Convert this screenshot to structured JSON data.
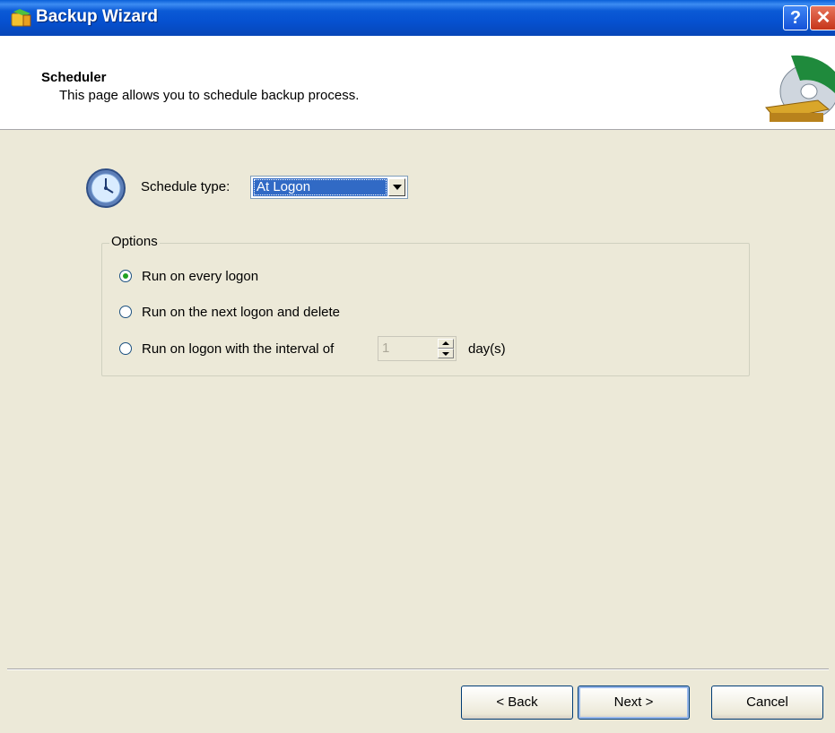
{
  "window": {
    "title": "Backup Wizard",
    "help_label": "?",
    "close_label": "✕"
  },
  "header": {
    "title": "Scheduler",
    "subtitle": "This page allows you to schedule backup process."
  },
  "schedule": {
    "label": "Schedule type:",
    "value": "At Logon"
  },
  "options": {
    "group_label": "Options",
    "radios": [
      {
        "label": "Run on every logon",
        "checked": true
      },
      {
        "label": "Run on the next logon and delete",
        "checked": false
      },
      {
        "label": "Run on logon with the interval of",
        "checked": false
      }
    ],
    "interval_value": "1",
    "interval_unit": "day(s)"
  },
  "buttons": {
    "back": "< Back",
    "next": "Next >",
    "cancel": "Cancel"
  }
}
